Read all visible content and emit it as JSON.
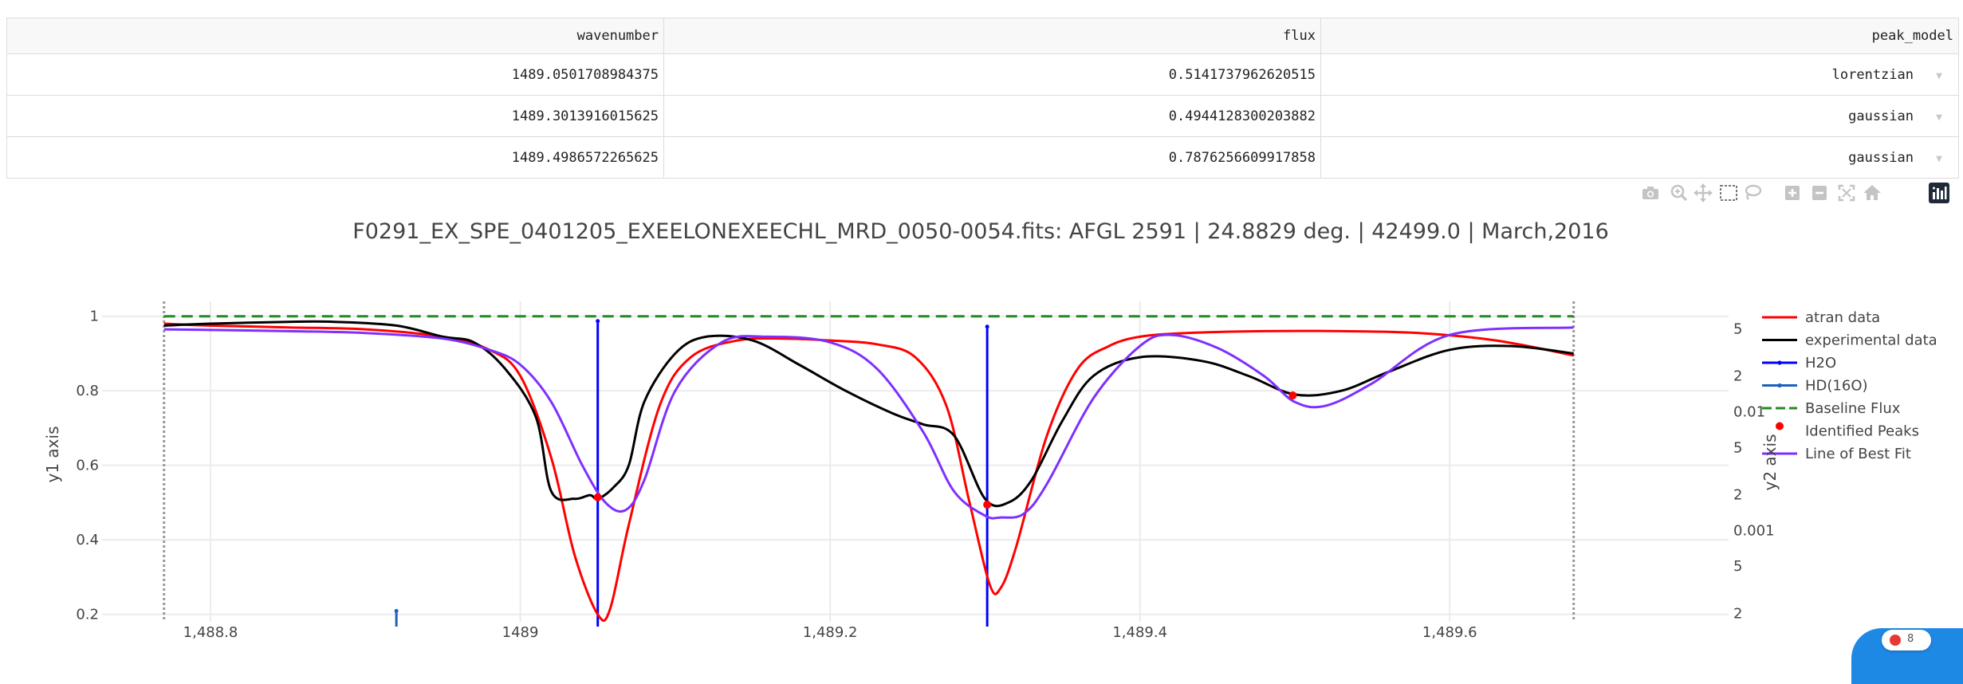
{
  "table": {
    "headers": [
      "wavenumber",
      "flux",
      "peak_model"
    ],
    "rows": [
      [
        "1489.0501708984375",
        "0.5141737962620515",
        "lorentzian"
      ],
      [
        "1489.3013916015625",
        "0.4944128300203882",
        "gaussian"
      ],
      [
        "1489.4986572265625",
        "0.7876256609917858",
        "gaussian"
      ]
    ]
  },
  "modebar": {
    "icons": [
      "camera-icon",
      "zoom-icon",
      "pan-icon",
      "box-select-icon",
      "lasso-select-icon",
      "zoom-in-icon",
      "zoom-out-icon",
      "autoscale-icon",
      "reset-axes-icon",
      "plotly-logo-icon"
    ]
  },
  "badge": {
    "count": "8",
    "dot_color": "#e53935"
  },
  "chart_data": {
    "type": "line",
    "title": "F0291_EX_SPE_0401205_EXEELONEXEECHL_MRD_0050-0054.fits:  AFGL 2591 | 24.8829 deg. | 42499.0 | March,2016",
    "xlabel": "",
    "ylabel": "y1 axis",
    "y2label": "y2 axis",
    "xlim": [
      1488.73,
      1489.78
    ],
    "ylim": [
      0.18,
      1.04
    ],
    "y2_scale": "log",
    "y2lim": [
      0.00017,
      0.085
    ],
    "x_ticks": [
      1488.8,
      1489.0,
      1489.2,
      1489.4,
      1489.6
    ],
    "x_tick_labels": [
      "1,488.8",
      "1489",
      "1,489.2",
      "1,489.4",
      "1,489.6"
    ],
    "y_ticks": [
      0.2,
      0.4,
      0.6,
      0.8,
      1.0
    ],
    "y_tick_labels": [
      "0.2",
      "0.4",
      "0.6",
      "0.8",
      "1"
    ],
    "y2_ticks": [
      0.0002,
      0.0005,
      0.001,
      0.002,
      0.005,
      0.01,
      0.02,
      0.05
    ],
    "y2_tick_labels": [
      "2",
      "5",
      "0.001",
      "2",
      "5",
      "0.01",
      "2",
      "5"
    ],
    "grid": true,
    "legend_position": "right",
    "range_bounds_x": [
      1488.77,
      1489.68
    ],
    "series": [
      {
        "name": "atran data",
        "color": "#ff0000",
        "style": "line",
        "x": [
          1488.77,
          1488.8,
          1488.85,
          1488.9,
          1488.95,
          1488.98,
          1489.0,
          1489.02,
          1489.035,
          1489.05,
          1489.058,
          1489.07,
          1489.09,
          1489.11,
          1489.14,
          1489.17,
          1489.2,
          1489.23,
          1489.255,
          1489.275,
          1489.29,
          1489.303,
          1489.31,
          1489.32,
          1489.34,
          1489.36,
          1489.38,
          1489.4,
          1489.43,
          1489.48,
          1489.53,
          1489.58,
          1489.63,
          1489.68
        ],
        "y": [
          0.98,
          0.975,
          0.97,
          0.965,
          0.945,
          0.91,
          0.84,
          0.62,
          0.36,
          0.2,
          0.215,
          0.44,
          0.76,
          0.89,
          0.935,
          0.94,
          0.935,
          0.925,
          0.89,
          0.76,
          0.5,
          0.28,
          0.27,
          0.38,
          0.68,
          0.86,
          0.92,
          0.945,
          0.955,
          0.96,
          0.96,
          0.955,
          0.935,
          0.895
        ]
      },
      {
        "name": "experimental data",
        "color": "#000000",
        "style": "line",
        "x": [
          1488.77,
          1488.8,
          1488.85,
          1488.88,
          1488.92,
          1488.95,
          1488.97,
          1488.99,
          1489.01,
          1489.02,
          1489.035,
          1489.045,
          1489.05,
          1489.06,
          1489.07,
          1489.08,
          1489.1,
          1489.12,
          1489.15,
          1489.18,
          1489.21,
          1489.24,
          1489.26,
          1489.28,
          1489.3,
          1489.315,
          1489.33,
          1489.35,
          1489.37,
          1489.4,
          1489.44,
          1489.47,
          1489.5,
          1489.53,
          1489.56,
          1489.6,
          1489.64,
          1489.68
        ],
        "y": [
          0.975,
          0.98,
          0.985,
          0.985,
          0.975,
          0.945,
          0.93,
          0.86,
          0.73,
          0.53,
          0.51,
          0.52,
          0.51,
          0.54,
          0.6,
          0.77,
          0.9,
          0.945,
          0.935,
          0.87,
          0.8,
          0.74,
          0.71,
          0.68,
          0.51,
          0.5,
          0.56,
          0.72,
          0.84,
          0.89,
          0.88,
          0.84,
          0.79,
          0.8,
          0.85,
          0.91,
          0.92,
          0.9
        ]
      },
      {
        "name": "Line of Best Fit",
        "color": "#7f2fff",
        "style": "line",
        "x": [
          1488.77,
          1488.85,
          1488.9,
          1488.95,
          1488.98,
          1489.0,
          1489.02,
          1489.04,
          1489.055,
          1489.068,
          1489.08,
          1489.1,
          1489.13,
          1489.16,
          1489.2,
          1489.23,
          1489.26,
          1489.28,
          1489.3,
          1489.31,
          1489.325,
          1489.34,
          1489.37,
          1489.4,
          1489.42,
          1489.45,
          1489.48,
          1489.5,
          1489.52,
          1489.55,
          1489.6,
          1489.68
        ],
        "y": [
          0.965,
          0.96,
          0.955,
          0.94,
          0.91,
          0.87,
          0.77,
          0.6,
          0.5,
          0.48,
          0.56,
          0.8,
          0.93,
          0.945,
          0.93,
          0.86,
          0.69,
          0.53,
          0.465,
          0.46,
          0.47,
          0.55,
          0.78,
          0.92,
          0.95,
          0.915,
          0.84,
          0.77,
          0.76,
          0.82,
          0.95,
          0.97
        ]
      },
      {
        "name": "Baseline Flux",
        "color": "#228b22",
        "style": "dash",
        "x": [
          1488.77,
          1489.68
        ],
        "y": [
          1.0,
          1.0
        ]
      }
    ],
    "markers": {
      "name": "Identified Peaks",
      "color": "#ff0000",
      "x": [
        1489.05,
        1489.3014,
        1489.4987
      ],
      "y": [
        0.5142,
        0.4944,
        0.7876
      ]
    },
    "sticks": [
      {
        "name": "H2O",
        "color": "#0000ff",
        "axis": "y2",
        "x": [
          1489.05,
          1489.3014
        ],
        "y": [
          0.058,
          0.052
        ]
      },
      {
        "name": "HD(16O)",
        "color": "#1f5fbf",
        "axis": "y2",
        "x": [
          1488.92
        ],
        "y": [
          0.00021
        ]
      }
    ],
    "legend": [
      "atran data",
      "experimental data",
      "H2O",
      "HD(16O)",
      "Baseline Flux",
      "Identified Peaks",
      "Line of Best Fit"
    ]
  }
}
